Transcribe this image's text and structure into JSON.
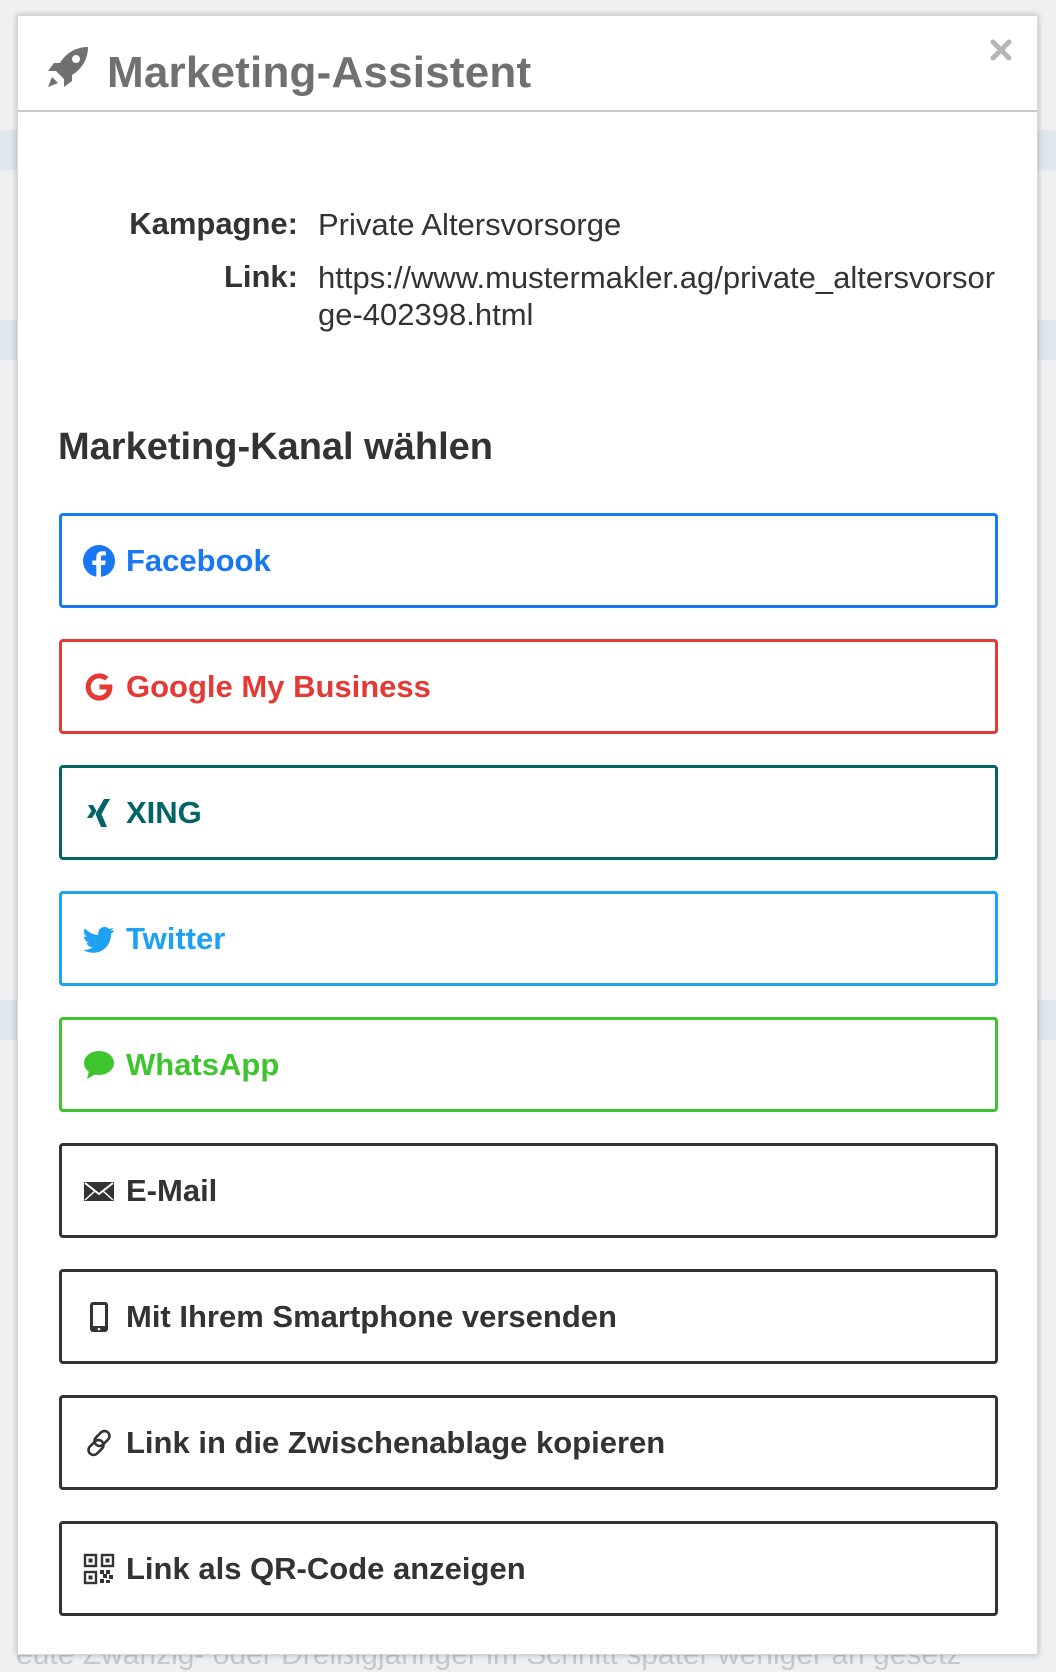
{
  "modal": {
    "title": "Marketing-Assistent",
    "title_icon": "rocket-icon",
    "close_icon": "close-icon"
  },
  "info": {
    "campaign_label": "Kampagne:",
    "campaign_value": "Private Altersvorsorge",
    "link_label": "Link:",
    "link_value": "https://www.mustermakler.ag/private_altersvorsorge-402398.html"
  },
  "section_title": "Marketing-Kanal wählen",
  "background_text": "eute Zwanzig- oder Dreißigjähriger im Schnitt später weniger an gesetz",
  "channels": [
    {
      "label": "Facebook",
      "icon": "facebook-icon",
      "color": "#1877f2"
    },
    {
      "label": "Google My Business",
      "icon": "google-icon",
      "color": "#e53935"
    },
    {
      "label": "XING",
      "icon": "xing-icon",
      "color": "#026466"
    },
    {
      "label": "Twitter",
      "icon": "twitter-icon",
      "color": "#1da1f2"
    },
    {
      "label": "WhatsApp",
      "icon": "whatsapp-icon",
      "color": "#3ec42f"
    },
    {
      "label": "E-Mail",
      "icon": "envelope-icon",
      "color": "#333333"
    },
    {
      "label": "Mit Ihrem Smartphone versenden",
      "icon": "smartphone-icon",
      "color": "#333333"
    },
    {
      "label": "Link in die Zwischenablage kopieren",
      "icon": "link-icon",
      "color": "#333333"
    },
    {
      "label": "Link als QR-Code anzeigen",
      "icon": "qrcode-icon",
      "color": "#333333"
    }
  ]
}
